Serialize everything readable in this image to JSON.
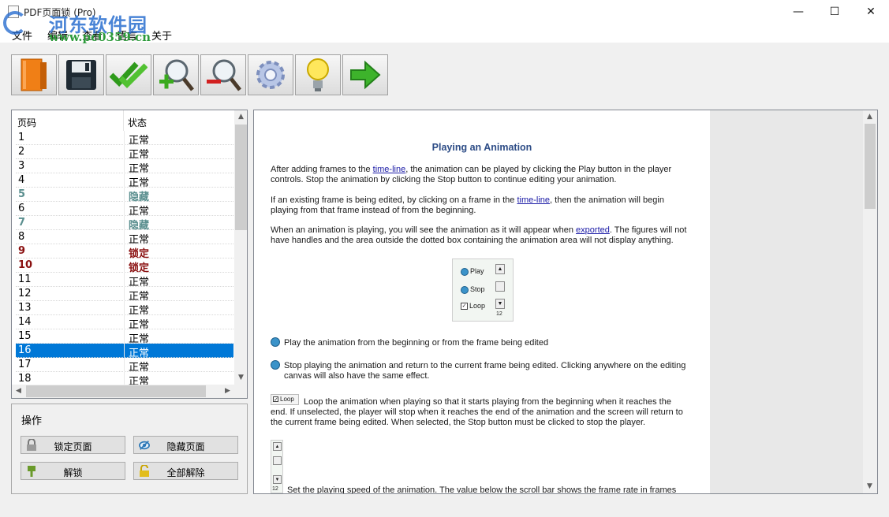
{
  "window": {
    "title": "PDF页面锁 (Pro)",
    "minimize": "—",
    "maximize": "☐",
    "close": "✕"
  },
  "watermark": {
    "site_name": "河东软件园",
    "url": "www.pc0359.cn"
  },
  "menu": [
    "文件",
    "编辑",
    "查看",
    "语言",
    "关于"
  ],
  "toolbar": {
    "buttons": [
      "open-book-icon",
      "save-disk-icon",
      "double-check-icon",
      "zoom-in-icon",
      "zoom-out-icon",
      "settings-gear-icon",
      "lightbulb-icon",
      "next-arrow-icon"
    ]
  },
  "page_list": {
    "columns": [
      "页码",
      "状态"
    ],
    "rows": [
      {
        "page": "1",
        "status": "正常"
      },
      {
        "page": "2",
        "status": "正常"
      },
      {
        "page": "3",
        "status": "正常"
      },
      {
        "page": "4",
        "status": "正常"
      },
      {
        "page": "5",
        "status": "隐藏"
      },
      {
        "page": "6",
        "status": "正常"
      },
      {
        "page": "7",
        "status": "隐藏"
      },
      {
        "page": "8",
        "status": "正常"
      },
      {
        "page": "9",
        "status": "锁定"
      },
      {
        "page": "10",
        "status": "锁定"
      },
      {
        "page": "11",
        "status": "正常"
      },
      {
        "page": "12",
        "status": "正常"
      },
      {
        "page": "13",
        "status": "正常"
      },
      {
        "page": "14",
        "status": "正常"
      },
      {
        "page": "15",
        "status": "正常"
      },
      {
        "page": "16",
        "status": "正常"
      },
      {
        "page": "17",
        "status": "正常"
      },
      {
        "page": "18",
        "status": "正常"
      }
    ],
    "selected_page": "16",
    "colors": {
      "hidden": "#5b8f8f",
      "locked": "#8a1010",
      "selected": "#0078d7"
    }
  },
  "operations": {
    "title": "操作",
    "lock_page": "锁定页面",
    "hide_page": "隐藏页面",
    "unlock": "解锁",
    "unlock_all": "全部解除"
  },
  "document": {
    "heading": "Playing an Animation",
    "p1_a": "After adding frames to the ",
    "p1_link": "time-line",
    "p1_b": ", the animation can be played by clicking the Play button in the player controls. Stop the animation by clicking the Stop button to continue editing your animation.",
    "p2_a": "If an existing frame is being edited, by clicking on a frame in the ",
    "p2_link": "time-line",
    "p2_b": ", then the animation will begin playing from that frame instead of from the beginning.",
    "p3_a": "When an animation is playing, you will see the animation as it will appear when ",
    "p3_link": "exported",
    "p3_b": ". The figures will not have handles and the area outside the dotted box containing the animation area will not display anything.",
    "ctrl_play": "Play",
    "ctrl_stop": "Stop",
    "ctrl_loop": "Loop",
    "ctrl_rate": "12",
    "b1": "Play the animation from the beginning or from the frame being edited",
    "b2": "Stop playing the animation and return to the current frame being edited. Clicking anywhere on the editing canvas will also have the same effect.",
    "loop_label": "Loop",
    "b3": "Loop the animation when playing so that it starts playing from the beginning when it reaches the end. If unselected, the player will stop when it reaches the end of the animation and the screen will return to the current frame being edited. When selected, the Stop button must be clicked to stop the player.",
    "speed_rate": "12",
    "b4": "Set the playing speed of the animation. The value below the scroll bar shows the frame rate in frames per"
  }
}
